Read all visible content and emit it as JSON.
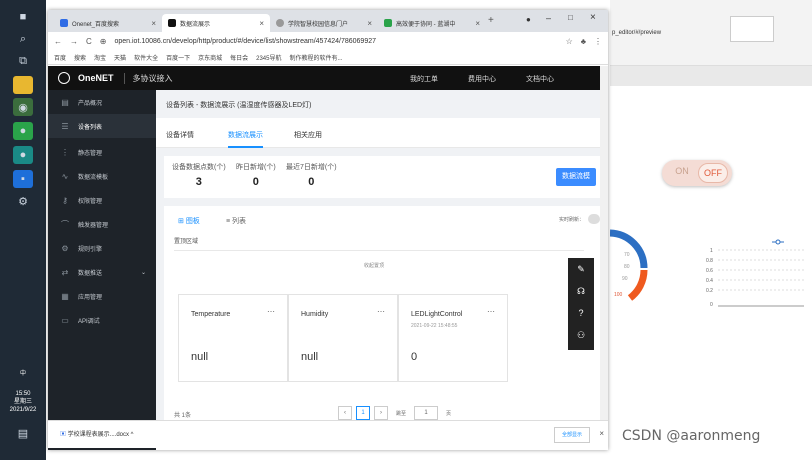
{
  "taskbar": {
    "clock_time": "15:50",
    "clock_day": "星期三",
    "clock_date": "2021/9/22",
    "ime": "中"
  },
  "browser": {
    "tabs": [
      {
        "title": "Onenet_百度搜索"
      },
      {
        "title": "数据流展示"
      },
      {
        "title": "学院智慧校园信息门户"
      },
      {
        "title": "高效便于协同 - 蓝湖中"
      }
    ],
    "url": "open.iot.10086.cn/develop/http/product/#/device/list/showstream/457424/786069927",
    "bookmarks": [
      "百度",
      "搜索",
      "淘宝",
      "天猫",
      "软件大全",
      "百度一下",
      "京东商城",
      "每日会",
      "2345导航",
      "制作教程的软件有..."
    ]
  },
  "onenet": {
    "logo": "OneNET",
    "protocol": "多协议接入",
    "nav": [
      "我的工单",
      "费用中心",
      "文档中心"
    ]
  },
  "sidebar": {
    "items": [
      {
        "label": "产品概况"
      },
      {
        "label": "设备列表"
      },
      {
        "label": "静态管理"
      },
      {
        "label": "数据流模板"
      },
      {
        "label": "权限管理"
      },
      {
        "label": "触发器管理"
      },
      {
        "label": "规则引擎"
      },
      {
        "label": "数据推送"
      },
      {
        "label": "应用管理"
      },
      {
        "label": "API调试"
      }
    ]
  },
  "main": {
    "breadcrumb": "设备列表 - 数据流展示 (温湿度传感器及LED灯)",
    "subtabs": [
      "设备详情",
      "数据流展示",
      "相关应用"
    ],
    "stats": [
      {
        "label": "设备数据点数(个)",
        "value": "3"
      },
      {
        "label": "昨日新增(个)",
        "value": "0"
      },
      {
        "label": "最近7日新增(个)",
        "value": "0"
      }
    ],
    "stream_button": "数据流模",
    "view_tabs": [
      "图板",
      "列表"
    ],
    "realtime_label": "实时刷新：",
    "area_label": "置顶区域",
    "collapse_label": "收起置顶",
    "cards": [
      {
        "name": "Temperature",
        "time": "",
        "value": "null"
      },
      {
        "name": "Humidity",
        "time": "",
        "value": "null"
      },
      {
        "name": "LEDLightControl",
        "time": "2021-09-22 15:48:55",
        "value": "0"
      }
    ],
    "pager": {
      "total": "共 1条",
      "current": "1",
      "goto_label": "跳至",
      "goto_value": "1",
      "page_unit": "页"
    }
  },
  "downloads": {
    "file": "学校课程表展示....docx",
    "show_all": "全部显示"
  },
  "background_app": {
    "url": "p_editor/#/preview",
    "toggle_on": "ON",
    "toggle_off": "OFF",
    "gauge_labels": [
      "70",
      "80",
      "90",
      "100"
    ],
    "chart_y_ticks": [
      "1",
      "0.8",
      "0.6",
      "0.4",
      "0.2",
      "0"
    ]
  },
  "watermark": "CSDN @aaronmeng"
}
